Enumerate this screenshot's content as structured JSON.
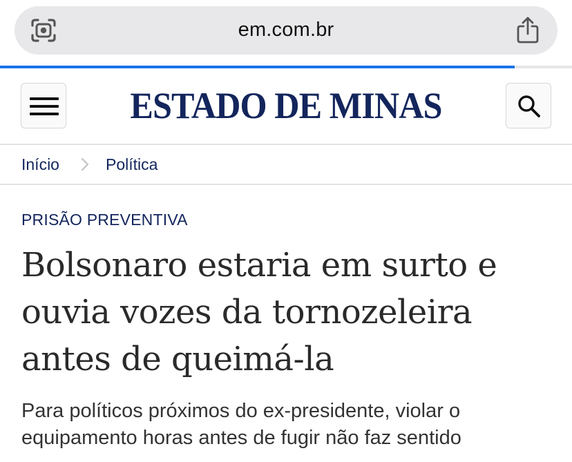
{
  "browser": {
    "url": "em.com.br",
    "progress": 0.9,
    "accent_color": "#1a73e8"
  },
  "header": {
    "site_name": "ESTADO DE MINAS",
    "brand_color": "#13255c",
    "menu_icon": "hamburger-menu-icon",
    "search_icon": "search-icon"
  },
  "breadcrumb": {
    "items": [
      "Início",
      "Política"
    ],
    "separator_icon": "chevron-right-icon"
  },
  "article": {
    "kicker": "PRISÃO PREVENTIVA",
    "headline": "Bolsonaro estaria em surto e ouvia vozes da tornozeleira antes de queimá-la",
    "subtitle": "Para políticos próximos do ex-presidente, violar o equipamento horas antes de fugir não faz sentido"
  }
}
